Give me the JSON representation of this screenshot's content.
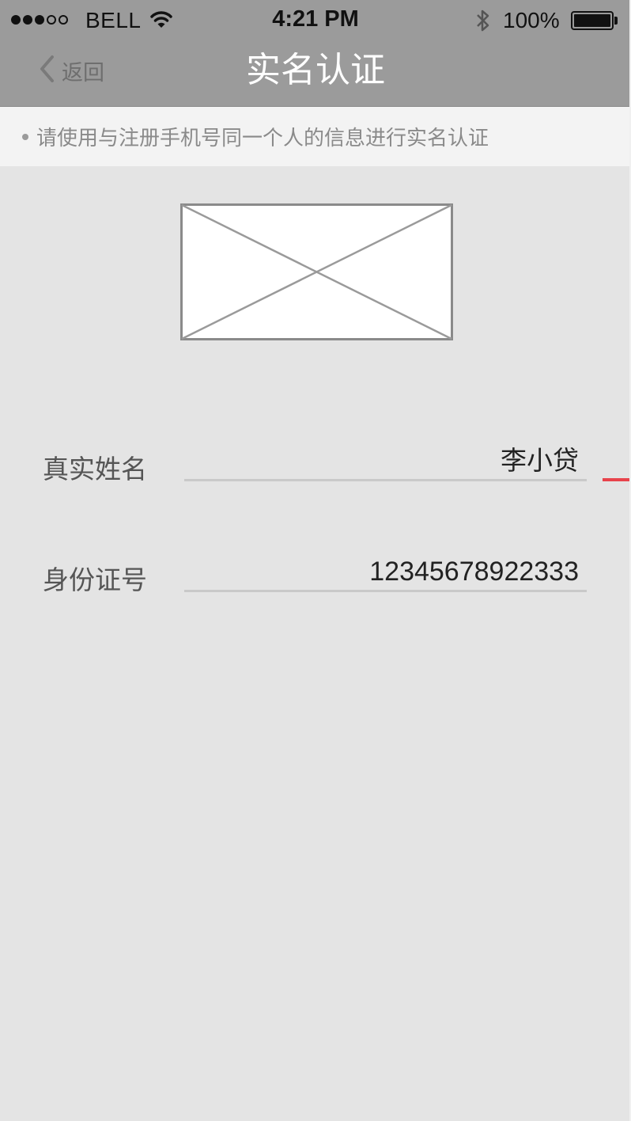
{
  "status_bar": {
    "carrier": "BELL",
    "time": "4:21 PM",
    "battery_percent": "100%",
    "signal_bars_filled": 3,
    "signal_bars_total": 5,
    "icons": [
      "signal-dots-icon",
      "wifi-icon",
      "bluetooth-icon",
      "battery-icon"
    ]
  },
  "nav": {
    "back_label": "返回",
    "title": "实名认证"
  },
  "notice": {
    "text": "请使用与注册手机号同一个人的信息进行实名认证"
  },
  "id_image": {
    "icon": "image-placeholder-icon"
  },
  "form": {
    "name_label": "真实姓名",
    "name_value": "李小贷",
    "id_label": "身份证号",
    "id_value": "12345678922333"
  },
  "colors": {
    "nav_background": "#9b9b9b",
    "page_background": "#e4e4e4",
    "notice_background": "#f3f3f3",
    "accent": "#e8434b"
  }
}
